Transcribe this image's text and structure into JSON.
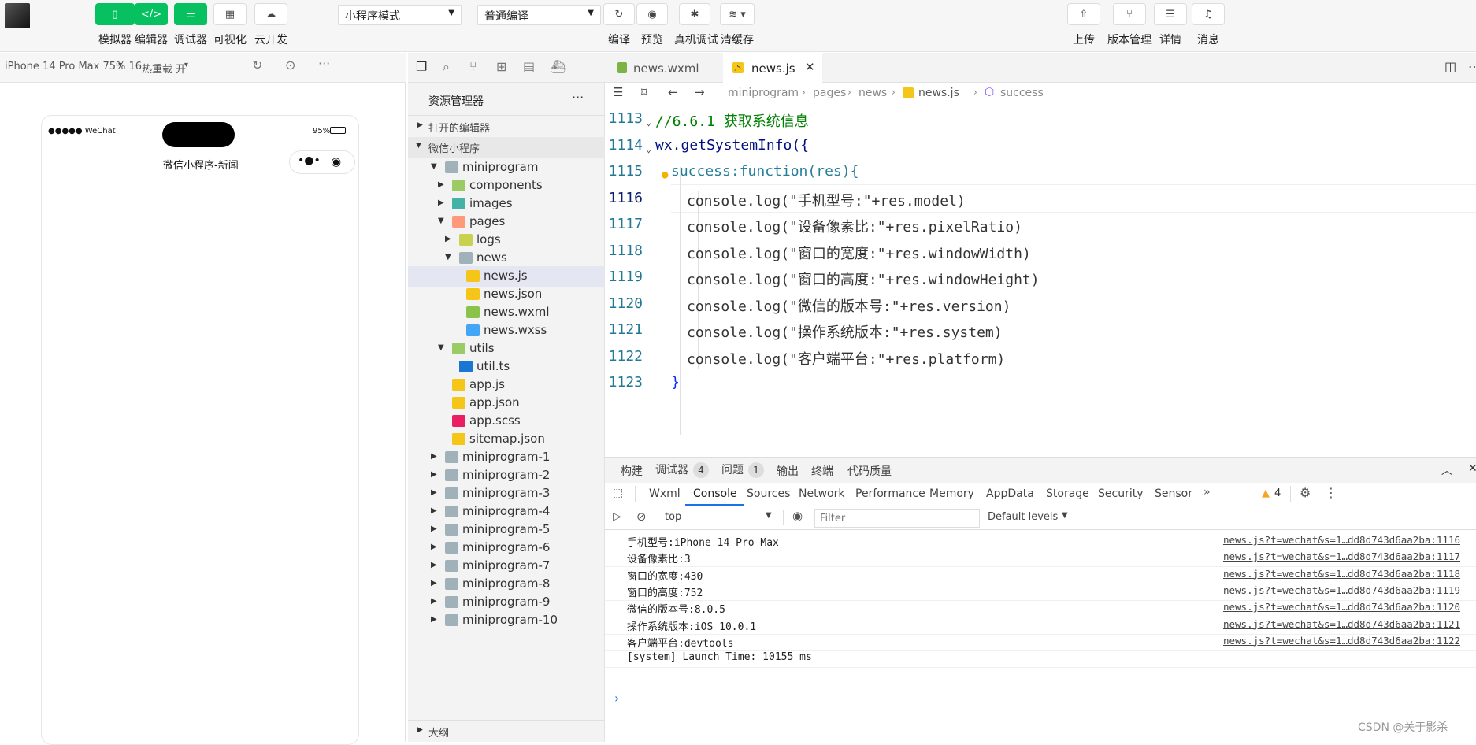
{
  "toolbar": {
    "buttons_left": [
      {
        "label": "模拟器"
      },
      {
        "label": "编辑器"
      },
      {
        "label": "调试器"
      },
      {
        "label": "可视化"
      },
      {
        "label": "云开发"
      }
    ],
    "mode_select": "小程序模式",
    "compile_select": "普通编译",
    "buttons_mid": [
      {
        "label": "编译"
      },
      {
        "label": "预览"
      },
      {
        "label": "真机调试"
      },
      {
        "label": "清缓存"
      }
    ],
    "buttons_right": [
      {
        "label": "上传"
      },
      {
        "label": "版本管理"
      },
      {
        "label": "详情"
      },
      {
        "label": "消息"
      }
    ]
  },
  "simbar": {
    "device": "iPhone 14 Pro Max 75% 16",
    "hotreload": "热重载 开"
  },
  "phone": {
    "carrier": "●●●●● WeChat",
    "battery": "95%",
    "title": "微信小程序-新闻"
  },
  "editor_tabs": [
    {
      "label": "news.wxml",
      "icon": "wxml"
    },
    {
      "label": "news.js",
      "icon": "JS"
    }
  ],
  "breadcrumb": {
    "parts": [
      "miniprogram",
      "pages",
      "news",
      "news.js",
      "success"
    ]
  },
  "explorer": {
    "title": "资源管理器",
    "open_editors": "打开的编辑器",
    "project": "微信小程序",
    "outline": "大纲",
    "tree": [
      {
        "label": "miniprogram",
        "depth": 1,
        "arrow": "▼",
        "icon": "folder"
      },
      {
        "label": "components",
        "depth": 2,
        "arrow": "▶",
        "icon": "folder-green"
      },
      {
        "label": "images",
        "depth": 2,
        "arrow": "▶",
        "icon": "folder-teal"
      },
      {
        "label": "pages",
        "depth": 2,
        "arrow": "▼",
        "icon": "folder-orange"
      },
      {
        "label": "logs",
        "depth": 3,
        "arrow": "▶",
        "icon": "folder-yellow"
      },
      {
        "label": "news",
        "depth": 3,
        "arrow": "▼",
        "icon": "folder"
      },
      {
        "label": "news.js",
        "depth": 4,
        "arrow": "",
        "icon": "js"
      },
      {
        "label": "news.json",
        "depth": 4,
        "arrow": "",
        "icon": "json"
      },
      {
        "label": "news.wxml",
        "depth": 4,
        "arrow": "",
        "icon": "wxml"
      },
      {
        "label": "news.wxss",
        "depth": 4,
        "arrow": "",
        "icon": "wxss"
      },
      {
        "label": "utils",
        "depth": 2,
        "arrow": "▼",
        "icon": "folder-green"
      },
      {
        "label": "util.ts",
        "depth": 3,
        "arrow": "",
        "icon": "ts"
      },
      {
        "label": "app.js",
        "depth": 2,
        "arrow": "",
        "icon": "js"
      },
      {
        "label": "app.json",
        "depth": 2,
        "arrow": "",
        "icon": "json"
      },
      {
        "label": "app.scss",
        "depth": 2,
        "arrow": "",
        "icon": "scss"
      },
      {
        "label": "sitemap.json",
        "depth": 2,
        "arrow": "",
        "icon": "json"
      },
      {
        "label": "miniprogram-1",
        "depth": 1,
        "arrow": "▶",
        "icon": "folder-grey"
      },
      {
        "label": "miniprogram-2",
        "depth": 1,
        "arrow": "▶",
        "icon": "folder-grey"
      },
      {
        "label": "miniprogram-3",
        "depth": 1,
        "arrow": "▶",
        "icon": "folder-grey"
      },
      {
        "label": "miniprogram-4",
        "depth": 1,
        "arrow": "▶",
        "icon": "folder-grey"
      },
      {
        "label": "miniprogram-5",
        "depth": 1,
        "arrow": "▶",
        "icon": "folder-grey"
      },
      {
        "label": "miniprogram-6",
        "depth": 1,
        "arrow": "▶",
        "icon": "folder-grey"
      },
      {
        "label": "miniprogram-7",
        "depth": 1,
        "arrow": "▶",
        "icon": "folder-grey"
      },
      {
        "label": "miniprogram-8",
        "depth": 1,
        "arrow": "▶",
        "icon": "folder-grey"
      },
      {
        "label": "miniprogram-9",
        "depth": 1,
        "arrow": "▶",
        "icon": "folder-grey"
      },
      {
        "label": "miniprogram-10",
        "depth": 1,
        "arrow": "▶",
        "icon": "folder-grey"
      }
    ]
  },
  "code": {
    "lines": [
      {
        "num": "1113",
        "text": "//6.6.1 获取系统信息"
      },
      {
        "num": "1114",
        "text": "wx.getSystemInfo({"
      },
      {
        "num": "1115",
        "text": "success:function(res){"
      },
      {
        "num": "1116",
        "text": "console.log(\"手机型号:\"+res.model)"
      },
      {
        "num": "1117",
        "text": "console.log(\"设备像素比:\"+res.pixelRatio)"
      },
      {
        "num": "1118",
        "text": "console.log(\"窗口的宽度:\"+res.windowWidth)"
      },
      {
        "num": "1119",
        "text": "console.log(\"窗口的高度:\"+res.windowHeight)"
      },
      {
        "num": "1120",
        "text": "console.log(\"微信的版本号:\"+res.version)"
      },
      {
        "num": "1121",
        "text": "console.log(\"操作系统版本:\"+res.system)"
      },
      {
        "num": "1122",
        "text": "console.log(\"客户端平台:\"+res.platform)"
      },
      {
        "num": "1123",
        "text": "}"
      }
    ],
    "current_line": "1116"
  },
  "devtools": {
    "panel_tabs": [
      {
        "label": "构建"
      },
      {
        "label": "调试器",
        "badge": "4"
      },
      {
        "label": "问题",
        "badge": "1"
      },
      {
        "label": "输出"
      },
      {
        "label": "终端"
      },
      {
        "label": "代码质量"
      }
    ],
    "tool_tabs": [
      "Wxml",
      "Console",
      "Sources",
      "Network",
      "Performance",
      "Memory",
      "AppData",
      "Storage",
      "Security",
      "Sensor"
    ],
    "active_tool_tab": "Console",
    "warning_count": "4",
    "context": "top",
    "filter_placeholder": "Filter",
    "levels": "Default levels",
    "console": [
      {
        "msg": "手机型号:iPhone 14 Pro Max",
        "src": "news.js?t=wechat&s=1…dd8d743d6aa2ba:1116"
      },
      {
        "msg": "设备像素比:3",
        "src": "news.js?t=wechat&s=1…dd8d743d6aa2ba:1117"
      },
      {
        "msg": "窗口的宽度:430",
        "src": "news.js?t=wechat&s=1…dd8d743d6aa2ba:1118"
      },
      {
        "msg": "窗口的高度:752",
        "src": "news.js?t=wechat&s=1…dd8d743d6aa2ba:1119"
      },
      {
        "msg": "微信的版本号:8.0.5",
        "src": "news.js?t=wechat&s=1…dd8d743d6aa2ba:1120"
      },
      {
        "msg": "操作系统版本:iOS 10.0.1",
        "src": "news.js?t=wechat&s=1…dd8d743d6aa2ba:1121"
      },
      {
        "msg": "客户端平台:devtools",
        "src": "news.js?t=wechat&s=1…dd8d743d6aa2ba:1122"
      },
      {
        "msg": "[system] Launch Time: 10155 ms",
        "src": ""
      }
    ],
    "prompt": "›"
  },
  "watermark": "CSDN @关于影杀",
  "colors": {
    "accent": "#07c160",
    "console_active": "#1a73e8",
    "line_num": "#237893"
  }
}
